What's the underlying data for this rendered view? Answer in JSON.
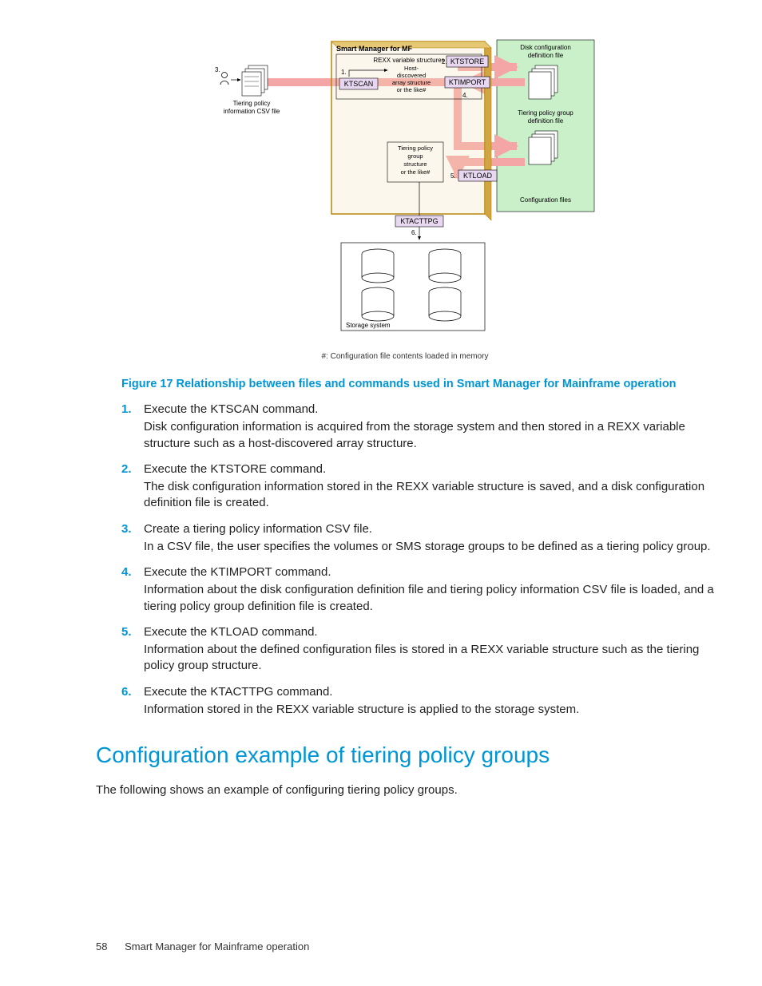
{
  "diagram": {
    "smart_mgr_title": "Smart Manager for MF",
    "rexx_title": "REXX variable structures",
    "host_struct_l1": "Host-",
    "host_struct_l2": "discovered",
    "host_struct_l3": "array structure",
    "host_struct_l4": "or the like#",
    "tpg_struct_l1": "Tiering policy",
    "tpg_struct_l2": "group",
    "tpg_struct_l3": "structure",
    "tpg_struct_l4": "or the like#",
    "cmd_ktscan": "KTSCAN",
    "cmd_ktstore": "KTSTORE",
    "cmd_ktimport": "KTIMPORT",
    "cmd_ktload": "KTLOAD",
    "cmd_ktacttpg": "KTACTTPG",
    "lbl_disk_cfg_l1": "Disk configuration",
    "lbl_disk_cfg_l2": "definition file",
    "lbl_tpg_def_l1": "Tiering policy group",
    "lbl_tpg_def_l2": "definition file",
    "lbl_cfg_files": "Configuration files",
    "lbl_csv_l1": "Tiering policy",
    "lbl_csv_l2": "information CSV file",
    "lbl_storage": "Storage system",
    "n1": "1.",
    "n2": "2.",
    "n3": "3.",
    "n4": "4.",
    "n5": "5.",
    "n6": "6.",
    "footnote": "#: Configuration file contents loaded in memory"
  },
  "figure_caption": "Figure 17 Relationship between files and commands used in Smart Manager for Mainframe operation",
  "steps": [
    {
      "head": "Execute the KTSCAN command.",
      "body": "Disk configuration information is acquired from the storage system and then stored in a REXX variable structure such as a host-discovered array structure."
    },
    {
      "head": "Execute the KTSTORE command.",
      "body": "The disk configuration information stored in the REXX variable structure is saved, and a disk configuration definition file is created."
    },
    {
      "head": "Create a tiering policy information CSV file.",
      "body": "In a CSV file, the user specifies the volumes or SMS storage groups to be defined as a tiering policy group."
    },
    {
      "head": "Execute the KTIMPORT command.",
      "body": "Information about the disk configuration definition file and tiering policy information CSV file is loaded, and a tiering policy group definition file is created."
    },
    {
      "head": "Execute the KTLOAD command.",
      "body": "Information about the defined configuration files is stored in a REXX variable structure such as the tiering policy group structure."
    },
    {
      "head": "Execute the KTACTTPG command.",
      "body": "Information stored in the REXX variable structure is applied to the storage system."
    }
  ],
  "section_heading": "Configuration example of tiering policy groups",
  "section_intro": "The following shows an example of configuring tiering policy groups.",
  "footer": {
    "page": "58",
    "title": "Smart Manager for Mainframe operation"
  }
}
